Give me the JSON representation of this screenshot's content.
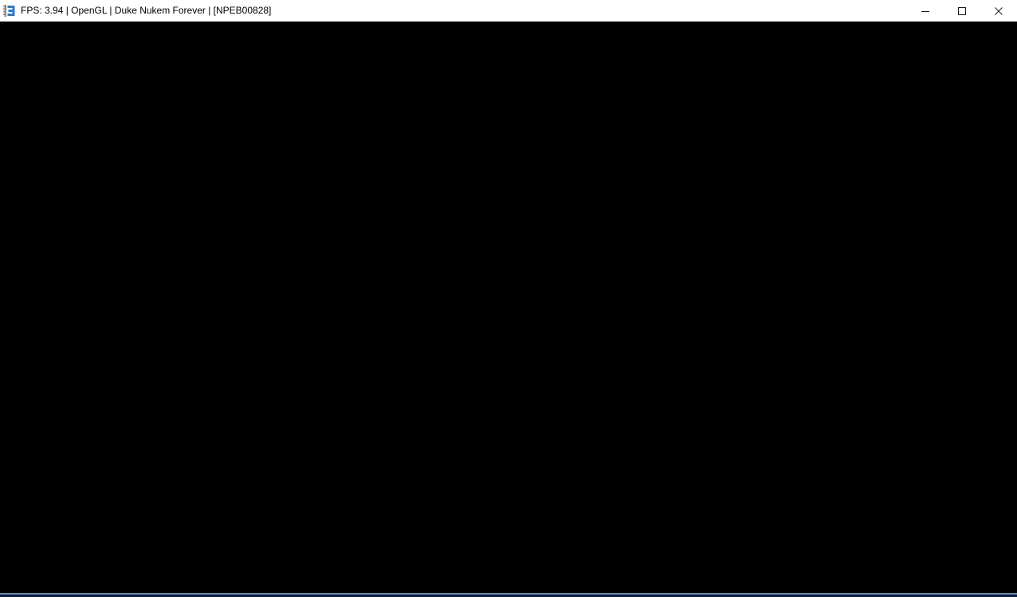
{
  "window": {
    "app_icon": "rpcs3-logo",
    "title": "FPS: 3.94 | OpenGL | Duke Nukem Forever | [NPEB00828]",
    "controls": [
      {
        "label": "Minimize",
        "icon": "minimize-icon"
      },
      {
        "label": "Maximize",
        "icon": "maximize-icon"
      },
      {
        "label": "Close",
        "icon": "close-icon"
      }
    ]
  },
  "game_screen": {
    "state": "black"
  },
  "colors": {
    "titlebar_bg": "#ffffff",
    "titlebar_text": "#000000",
    "content_bg": "#000000",
    "accent_border": "#4a90d9",
    "border_shadow": "#0e1f30",
    "icon_blue": "#2b7cd3",
    "icon_gray": "#8c8c8c"
  }
}
